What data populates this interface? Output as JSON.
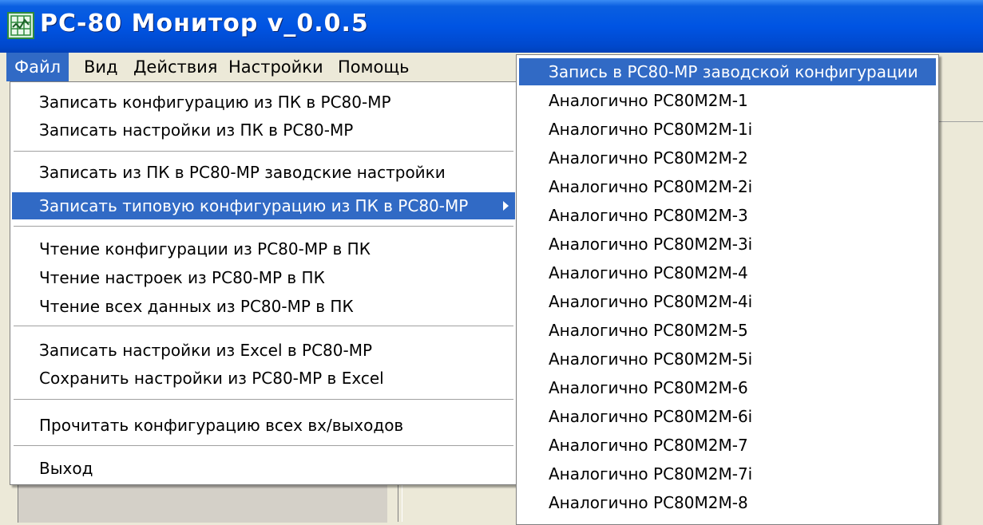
{
  "window": {
    "title": "РС-80 Монитор v_0.0.5",
    "app_icon": "grid-app-icon"
  },
  "menubar": {
    "items": [
      {
        "label": "Файл",
        "active": true
      },
      {
        "label": "Вид"
      },
      {
        "label": "Действия"
      },
      {
        "label": "Настройки"
      },
      {
        "label": "Помощь"
      }
    ]
  },
  "file_menu": {
    "items": [
      {
        "label": "Записать конфигурацию из ПК в РС80-МР"
      },
      {
        "label": "Записать настройки из ПК в РС80-МР"
      },
      {
        "label": "Записать из ПК в РС80-МР заводские настройки"
      },
      {
        "label": "Записать типовую конфигурацию из ПК в РС80-МР",
        "highlighted": true,
        "has_submenu": true
      },
      {
        "label": "Чтение конфигурации из РС80-МР в ПК"
      },
      {
        "label": "Чтение настроек из РС80-МР в ПК"
      },
      {
        "label": "Чтение всех данных из РС80-МР в ПК"
      },
      {
        "label": "Записать настройки из Excel в РС80-МР"
      },
      {
        "label": "Сохранить настройки из РС80-МР в Excel"
      },
      {
        "label": "Прочитать конфигурацию всех вх/выходов"
      },
      {
        "label": "Выход"
      }
    ]
  },
  "submenu": {
    "items": [
      {
        "label": "Запись в РС80-МР заводской конфигурации",
        "highlighted": true
      },
      {
        "label": "Аналогично РС80М2М-1"
      },
      {
        "label": "Аналогично РС80М2М-1i"
      },
      {
        "label": "Аналогично РС80М2М-2"
      },
      {
        "label": "Аналогично РС80М2М-2i"
      },
      {
        "label": "Аналогично РС80М2М-3"
      },
      {
        "label": "Аналогично РС80М2М-3i"
      },
      {
        "label": "Аналогично РС80М2М-4"
      },
      {
        "label": "Аналогично РС80М2М-4i"
      },
      {
        "label": "Аналогично РС80М2М-5"
      },
      {
        "label": "Аналогично РС80М2М-5i"
      },
      {
        "label": "Аналогично РС80М2М-6"
      },
      {
        "label": "Аналогично РС80М2М-6i"
      },
      {
        "label": "Аналогично РС80М2М-7"
      },
      {
        "label": "Аналогично РС80М2М-7i"
      },
      {
        "label": "Аналогично РС80М2М-8"
      }
    ]
  },
  "colors": {
    "highlight": "#316ac5",
    "titlebar": "#0054e3",
    "face": "#ece9d8"
  }
}
